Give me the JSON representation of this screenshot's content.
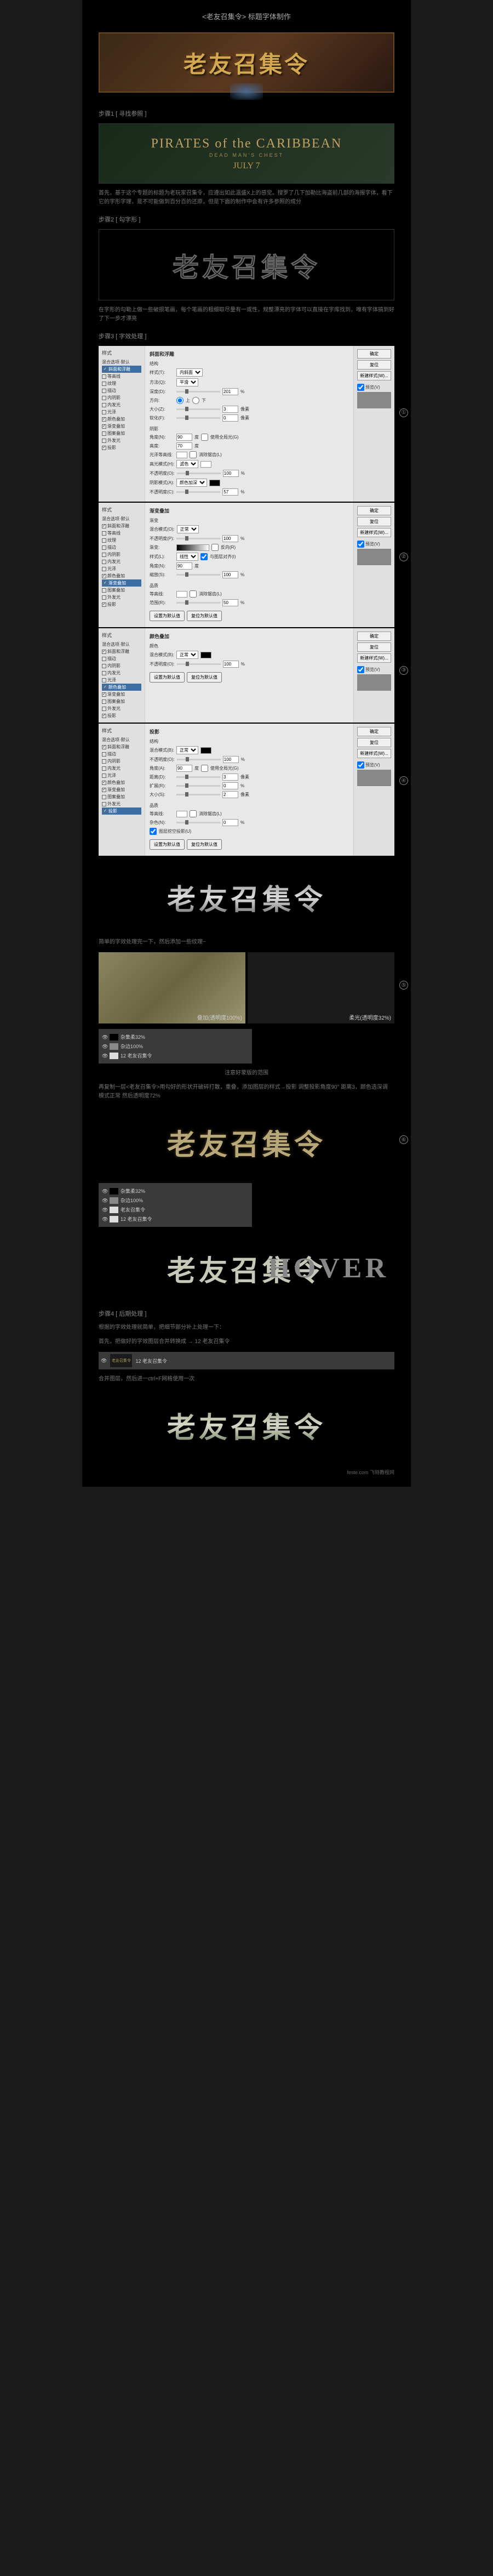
{
  "page_title": "<老友召集令> 标题字体制作",
  "hero_text": "老友召集令",
  "step1": {
    "label": "步骤1 [ 寻找参照 ]",
    "ref_title": "PIRATES of the CARIBBEAN",
    "ref_sub": "DEAD MAN'S CHEST",
    "ref_date": "JULY 7",
    "desc": "首先，基于这个专题的标题为老玩家召集令，应遵出如此温盛X上的感觉。搜罗了几下加勒比海盗前几部的海报字体，看下它的字形字理，是不可能做到百分百的还原，但是下面的制作中会有许多参照的成分"
  },
  "step2": {
    "label": "步骤2 [ 勾字形 ]",
    "text": "老友召集令",
    "desc": "在字形的勾勒上做一些破损笔画，每个笔画的粗细取尽量有一或性，规整漂亮的字体可以直接在字库找到，唯有字体搞到好了下一步才漂亮"
  },
  "step3": {
    "label": "步骤3 [ 字效处理 ]",
    "side_header": "样式",
    "side_items": [
      "混合选项·默认",
      "斜面和浮雕",
      "等高线",
      "纹理",
      "描边",
      "内阴影",
      "内发光",
      "光泽",
      "颜色叠加",
      "渐变叠加",
      "图案叠加",
      "外发光",
      "投影"
    ],
    "panel1": {
      "selected": "斜面和浮雕",
      "sect1": "斜面和浮雕",
      "sect1_sub": "结构",
      "style_lbl": "样式(T):",
      "style_val": "内斜面",
      "method_lbl": "方法(Q):",
      "method_val": "平滑",
      "depth_lbl": "深度(D):",
      "depth_val": "201",
      "depth_unit": "%",
      "dir_lbl": "方向:",
      "dir_up": "上",
      "dir_down": "下",
      "size_lbl": "大小(Z):",
      "size_val": "3",
      "size_unit": "像素",
      "soft_lbl": "软化(F):",
      "soft_val": "0",
      "soft_unit": "像素",
      "sect2": "阴影",
      "angle_lbl": "角度(N):",
      "angle_val": "90",
      "angle_unit": "度",
      "global_lbl": "使用全局光(G)",
      "alt_lbl": "高度:",
      "alt_val": "70",
      "alt_unit": "度",
      "gloss_lbl": "光泽等高线:",
      "anti_lbl": "消除锯齿(L)",
      "hl_lbl": "高光模式(H):",
      "hl_val": "滤色",
      "hl_op_lbl": "不透明度(O):",
      "hl_op_val": "100",
      "hl_op_unit": "%",
      "sh_lbl": "阴影模式(A):",
      "sh_val": "颜色加深",
      "sh_op_lbl": "不透明度(C):",
      "sh_op_val": "57",
      "sh_op_unit": "%"
    },
    "panel2": {
      "selected": "渐变叠加",
      "sect": "渐变叠加",
      "sect_sub": "渐变",
      "blend_lbl": "混合模式(O):",
      "blend_val": "正常",
      "op_lbl": "不透明度(P):",
      "op_val": "100",
      "op_unit": "%",
      "grad_lbl": "渐变:",
      "rev_lbl": "反向(R)",
      "style_lbl": "样式(L):",
      "style_val": "线性",
      "align_lbl": "与图层对齐(I)",
      "angle_lbl": "角度(N):",
      "angle_val": "90",
      "angle_unit": "度",
      "scale_lbl": "缩放(S):",
      "scale_val": "100",
      "scale_unit": "%",
      "sect2": "品质",
      "contour_lbl": "等高线:",
      "anti_lbl": "消除锯齿(L)",
      "range_lbl": "范围(R):",
      "range_val": "50",
      "range_unit": "%",
      "default_btn": "设置为默认值",
      "reset_btn": "复位为默认值"
    },
    "panel3": {
      "selected": "颜色叠加",
      "sect": "颜色叠加",
      "sect_sub": "颜色",
      "blend_lbl": "混合模式(B):",
      "blend_val": "正常",
      "op_lbl": "不透明度(O):",
      "op_val": "100",
      "op_unit": "%",
      "default_btn": "设置为默认值",
      "reset_btn": "复位为默认值"
    },
    "panel4": {
      "selected": "投影",
      "sect": "投影",
      "sect_sub": "结构",
      "blend_lbl": "混合模式(B):",
      "blend_val": "正常",
      "op_lbl": "不透明度(O):",
      "op_val": "100",
      "op_unit": "%",
      "angle_lbl": "角度(A):",
      "angle_val": "90",
      "angle_unit": "度",
      "global_lbl": "使用全局光(G)",
      "dist_lbl": "距离(D):",
      "dist_val": "3",
      "dist_unit": "像素",
      "spread_lbl": "扩展(R):",
      "spread_val": "0",
      "spread_unit": "%",
      "size_lbl": "大小(S):",
      "size_val": "2",
      "size_unit": "像素",
      "sect2": "品质",
      "contour_lbl": "等高线:",
      "anti_lbl": "消除锯齿(L)",
      "noise_lbl": "杂色(N):",
      "noise_val": "0",
      "noise_unit": "%",
      "knockout_lbl": "图层挖空投影(U)",
      "default_btn": "设置为默认值",
      "reset_btn": "复位为默认值"
    },
    "buttons": {
      "ok": "确定",
      "cancel": "复位",
      "new": "新建样式(W)...",
      "preview": "预览(V)"
    },
    "markers": [
      "①",
      "②",
      "③",
      "④",
      "⑤",
      "⑥"
    ],
    "desc_after": "简单的字效处理完一下，然后添加一些纹理~",
    "tex1_label": "叠加(透明度100%)",
    "tex2_label": "柔光(透明度32%)",
    "layers1": {
      "items": [
        {
          "name": "杂集柔32%",
          "sw": "bk"
        },
        {
          "name": "杂边100%",
          "sw": "gr"
        },
        {
          "name": "12 老友召集令",
          "sw": "wh"
        }
      ],
      "note": "注意好蒙版的范围"
    },
    "desc_mid": "再复制一层<老友召集令>用勾好的形状开破碎打散，重叠，添加图层的样式→投影 调整投影角度90° 距离3，颜色选深调 模式正常 然后透明度72%",
    "layers2": {
      "items": [
        {
          "name": "杂集柔32%",
          "sw": "bk"
        },
        {
          "name": "杂边100%",
          "sw": "gr"
        },
        {
          "name": "老友召集令",
          "sw": "wh"
        },
        {
          "name": "12 老友召集令",
          "sw": "wh"
        }
      ]
    },
    "hover": "HOVER"
  },
  "step4": {
    "label": "步骤4 [ 后期处理 ]",
    "desc1": "根据的字效处理就简单，把细节部分补上处理一下：",
    "desc2": "首先，把做好的字效图层合并转换成 → 12 老友召集令",
    "desc3": "合并图层，然后进一ctrl+F网格使用一次",
    "final_label": "12 老友召集令"
  },
  "watermark": "feste.com 飞特教程网"
}
